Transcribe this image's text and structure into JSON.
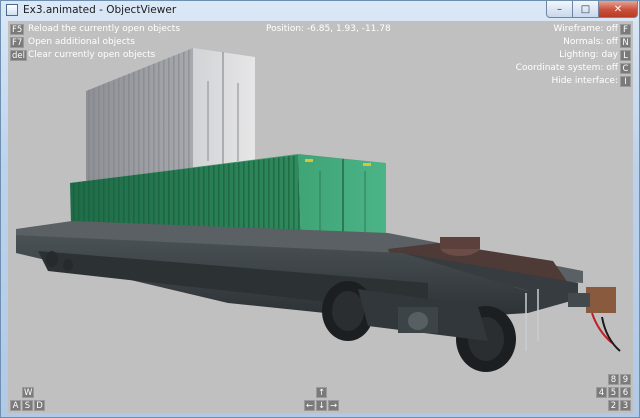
{
  "window": {
    "title": "Ex3.animated - ObjectViewer",
    "controls": {
      "minimize": "–",
      "maximize": "□",
      "close": "✕"
    }
  },
  "hud": {
    "left_commands": [
      {
        "key": "F5",
        "label": "Reload the currently open objects"
      },
      {
        "key": "F7",
        "label": "Open additional objects"
      },
      {
        "key": "del",
        "label": "Clear currently open objects"
      }
    ],
    "position": "Position: -6.85, 1.93, -11.78",
    "right_toggles": [
      {
        "label": "Wireframe: off",
        "key": "F"
      },
      {
        "label": "Normals: off",
        "key": "N"
      },
      {
        "label": "Lighting: day",
        "key": "L"
      },
      {
        "label": "Coordinate system: off",
        "key": "C"
      },
      {
        "label": "Hide interface:",
        "key": "I"
      }
    ],
    "left_keys": {
      "up": "W",
      "left": "A",
      "down": "S",
      "right": "D"
    },
    "center_keys": {
      "up": "↑",
      "left": "←",
      "down": "↓",
      "right": "→"
    },
    "numpad_keys": {
      "k8": "8",
      "k9": "9",
      "k4": "4",
      "k5": "5",
      "k6": "6",
      "k2": "2",
      "k3": "3"
    }
  },
  "colors": {
    "viewport_bg": "#c0c0c0",
    "container_gray": "#a9abb0",
    "container_green": "#2f8a5c",
    "wagon_body": "#3f4548"
  }
}
